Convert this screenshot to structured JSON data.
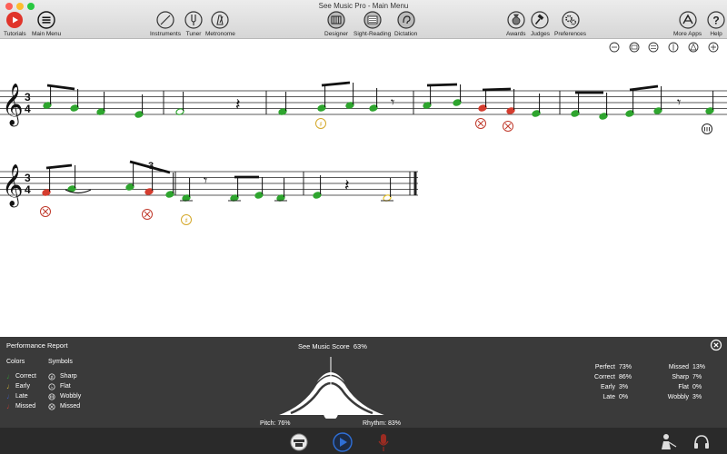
{
  "window": {
    "title": "See Music Pro - Main Menu"
  },
  "toolbar": {
    "tutorials": "Tutorials",
    "main_menu": "Main Menu",
    "instruments": "Instruments",
    "tuner": "Tuner",
    "metronome": "Metronome",
    "designer": "Designer",
    "sight_reading": "Sight-Reading",
    "dictation": "Dictation",
    "awards": "Awards",
    "judges": "Judges",
    "preferences": "Preferences",
    "more_apps": "More Apps",
    "help": "Help"
  },
  "score": {
    "time_signature_top": "3",
    "time_signature_bottom": "4",
    "tuplet": "3"
  },
  "report": {
    "title": "Performance Report",
    "score_label": "See Music Score",
    "score_value": "63%",
    "colors_header": "Colors",
    "symbols_header": "Symbols",
    "colors": [
      {
        "label": "Correct",
        "color": "#2ea52e"
      },
      {
        "label": "Early",
        "color": "#e6c229"
      },
      {
        "label": "Late",
        "color": "#3a5fd0"
      },
      {
        "label": "Missed",
        "color": "#d43c2e"
      }
    ],
    "symbols": [
      "Sharp",
      "Flat",
      "Wobbly",
      "Missed"
    ],
    "pitch_label": "Pitch:",
    "pitch_value": "76%",
    "rhythm_label": "Rhythm:",
    "rhythm_value": "83%",
    "stats_left": [
      {
        "label": "Perfect",
        "value": "73%"
      },
      {
        "label": "Correct",
        "value": "86%"
      },
      {
        "label": "Early",
        "value": "3%"
      },
      {
        "label": "Late",
        "value": "0%"
      }
    ],
    "stats_right": [
      {
        "label": "Missed",
        "value": "13%"
      },
      {
        "label": "Sharp",
        "value": "7%"
      },
      {
        "label": "Flat",
        "value": "0%"
      },
      {
        "label": "Wobbly",
        "value": "3%"
      }
    ]
  },
  "colors": {
    "correct": "#2ea52e",
    "early": "#e6c229",
    "late": "#3a5fd0",
    "missed": "#d43c2e",
    "record": "#c0392b",
    "play": "#2f6fd6"
  }
}
